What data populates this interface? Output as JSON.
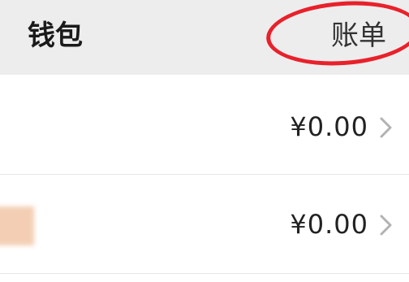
{
  "header": {
    "title": "钱包",
    "bill_label": "账单"
  },
  "rows": [
    {
      "amount": "¥0.00",
      "icon": "chevron-right-icon"
    },
    {
      "amount": "¥0.00",
      "icon": "chevron-right-icon"
    }
  ],
  "colors": {
    "header_bg": "#ededed",
    "highlight": "#e8212b",
    "chevron": "#b2b2b2"
  }
}
